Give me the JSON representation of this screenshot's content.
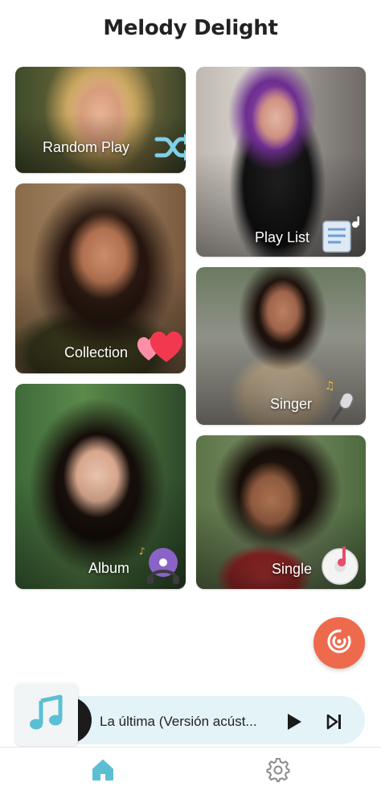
{
  "app": {
    "title": "Melody Delight"
  },
  "cards": [
    {
      "id": "random",
      "label": "Random Play",
      "icon": "shuffle-icon"
    },
    {
      "id": "playlist",
      "label": "Play List",
      "icon": "playlist-doc-icon"
    },
    {
      "id": "collection",
      "label": "Collection",
      "icon": "hearts-icon"
    },
    {
      "id": "singer",
      "label": "Singer",
      "icon": "microphone-icon"
    },
    {
      "id": "album",
      "label": "Album",
      "icon": "cd-headphones-icon"
    },
    {
      "id": "single",
      "label": "Single",
      "icon": "vinyl-disc-icon"
    }
  ],
  "player": {
    "track_title": "La última (Versión acúst...",
    "art_icon": "music-note-icon"
  },
  "nav": [
    {
      "id": "home",
      "icon": "home-icon",
      "active": true
    },
    {
      "id": "settings",
      "icon": "gear-icon",
      "active": false
    }
  ],
  "colors": {
    "accent": "#5bbfd4",
    "fab": "#ee6a4c",
    "player_bg": "#e4f3f8",
    "nav_inactive": "#8a8a8a"
  }
}
